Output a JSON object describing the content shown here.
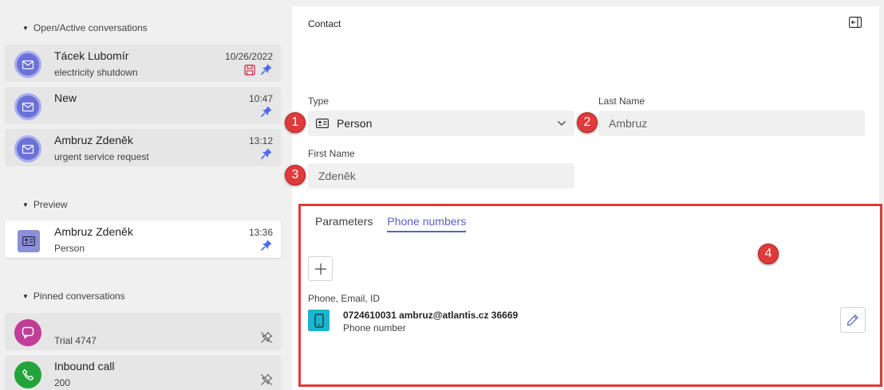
{
  "sections": {
    "open": "Open/Active conversations",
    "preview": "Preview",
    "pinned": "Pinned conversations"
  },
  "open_conversations": [
    {
      "name": "Tácek Lubomír",
      "subject": "electricity shutdown",
      "time": "10/26/2022",
      "icon": "mail-icon",
      "has_save_icon": true,
      "pinned": true
    },
    {
      "name": "New",
      "subject": "",
      "time": "10:47",
      "icon": "mail-icon",
      "has_save_icon": false,
      "pinned": true
    },
    {
      "name": "Ambruz Zdeněk",
      "subject": "urgent service request",
      "time": "13:12",
      "icon": "mail-icon",
      "has_save_icon": false,
      "pinned": true
    }
  ],
  "preview_conversation": {
    "name": "Ambruz Zdeněk",
    "subject": "Person",
    "time": "13:36",
    "icon": "contact-card-icon",
    "pinned": true
  },
  "pinned_conversations": [
    {
      "name": "",
      "subject": "Trial 4747",
      "icon": "chat-icon",
      "pinned": false
    },
    {
      "name": "Inbound call",
      "subject": "200",
      "icon": "phone-icon",
      "pinned": false
    }
  ],
  "contact": {
    "title": "Contact",
    "type_label": "Type",
    "type_value": "Person",
    "last_name_label": "Last Name",
    "last_name_value": "Ambruz",
    "first_name_label": "First Name",
    "first_name_value": "Zdeněk"
  },
  "tabs": [
    {
      "label": "Parameters",
      "active": false
    },
    {
      "label": "Phone numbers",
      "active": true
    }
  ],
  "phone_entries": {
    "column_label": "Phone, Email, ID",
    "items": [
      {
        "value": "0724610031 ambruz@atlantis.cz 36669",
        "type": "Phone number",
        "icon": "mobile-phone-icon"
      }
    ]
  },
  "callouts": [
    "1",
    "2",
    "3",
    "4"
  ],
  "colors": {
    "accent": "#5b5fc7",
    "callout": "#e03a3a",
    "mail_avatar": "#6b72d6",
    "chat_avatar": "#c03e98",
    "phone_avatar": "#23a43a",
    "phone_entry_icon": "#1ab5d0"
  }
}
